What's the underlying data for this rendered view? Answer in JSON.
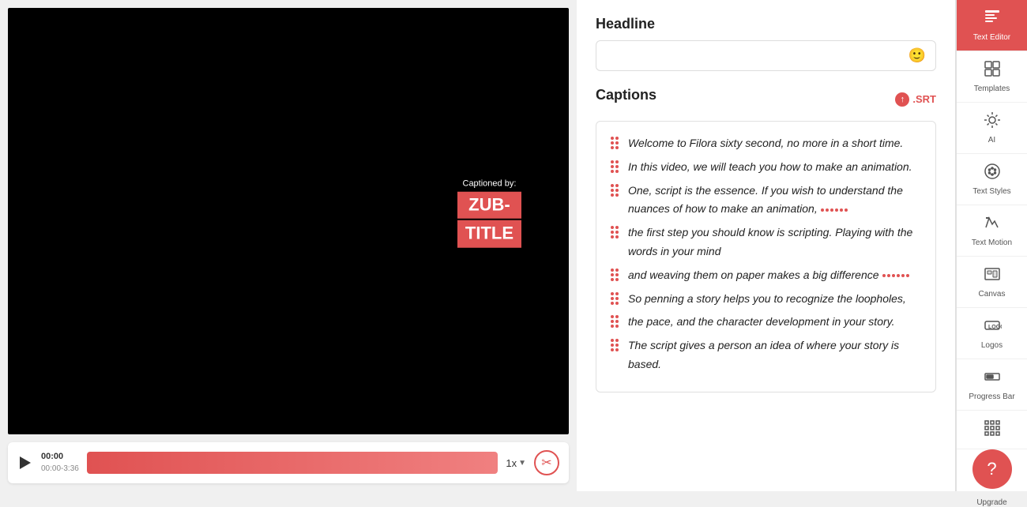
{
  "leftPanel": {
    "timeline": {
      "play_label": "play",
      "time_current": "00:00",
      "time_total": "00:00-3:36",
      "speed": "1x",
      "progress_pct": 100
    },
    "caption_overlay": {
      "captioned_by": "Captioned by:",
      "line1": "ZUB-",
      "line2": "TITLE"
    }
  },
  "middlePanel": {
    "headline_label": "Headline",
    "headline_placeholder": "",
    "captions_label": "Captions",
    "srt_label": ".SRT",
    "captions": [
      {
        "id": 1,
        "text": "Welcome to Filora sixty second, no more in a short time."
      },
      {
        "id": 2,
        "text": "In this video, we will teach you how to make an animation."
      },
      {
        "id": 3,
        "text": "One, script is the essence. If you wish to understand the nuances of how to make an animation,"
      },
      {
        "id": 4,
        "text": "the first step you should know is scripting. Playing with the words in your mind"
      },
      {
        "id": 5,
        "text": "and weaving them on paper makes a big difference"
      },
      {
        "id": 6,
        "text": "So penning a story helps you to recognize the loopholes,"
      },
      {
        "id": 7,
        "text": "the pace, and the character development in your story."
      },
      {
        "id": 8,
        "text": "The script gives a person an idea of where your story is based."
      }
    ]
  },
  "rightSidebar": {
    "items": [
      {
        "id": "text-editor",
        "label": "Text Editor",
        "icon": "text-editor",
        "active": true
      },
      {
        "id": "templates",
        "label": "Templates",
        "icon": "templates",
        "active": false
      },
      {
        "id": "ai",
        "label": "AI",
        "icon": "ai",
        "active": false
      },
      {
        "id": "text-styles",
        "label": "Text Styles",
        "icon": "text-styles",
        "active": false
      },
      {
        "id": "text-motion",
        "label": "Text Motion",
        "icon": "text-motion",
        "active": false
      },
      {
        "id": "canvas",
        "label": "Canvas",
        "icon": "canvas",
        "active": false
      },
      {
        "id": "logos",
        "label": "Logos",
        "icon": "logos",
        "active": false
      },
      {
        "id": "progress-bar",
        "label": "Progress Bar",
        "icon": "progress-bar",
        "active": false
      },
      {
        "id": "more",
        "label": "",
        "icon": "more",
        "active": false
      }
    ],
    "upgrade_label": "Upgrade"
  }
}
